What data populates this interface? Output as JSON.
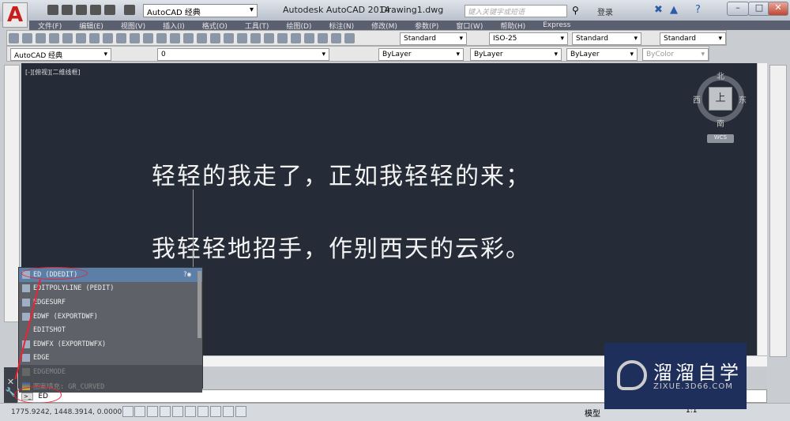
{
  "titlebar": {
    "app_title": "Autodesk AutoCAD 2014",
    "doc_title": "Drawing1.dwg",
    "workspace": "AutoCAD 经典",
    "search_placeholder": "键入关键字或短语",
    "login": "登录"
  },
  "menu": [
    "文件(F)",
    "编辑(E)",
    "视图(V)",
    "插入(I)",
    "格式(O)",
    "工具(T)",
    "绘图(D)",
    "标注(N)",
    "修改(M)",
    "参数(P)",
    "窗口(W)",
    "帮助(H)",
    "Express"
  ],
  "toolbar": {
    "text_style": "Standard",
    "dim_style": "ISO-25",
    "table_style": "Standard",
    "mleader_style": "Standard",
    "workspace": "AutoCAD 经典",
    "layer": "0",
    "color": "ByLayer",
    "linetype": "ByLayer",
    "lineweight": "ByLayer",
    "plotstyle": "ByColor"
  },
  "canvas": {
    "view_label": "[-][俯视][二维线框]",
    "line1": "轻轻的我走了，正如我轻轻的来；",
    "line2": "我轻轻地招手，作别西天的云彩。"
  },
  "viewcube": {
    "north": "北",
    "south": "南",
    "east": "东",
    "west": "西",
    "face": "上",
    "wcs": "WCS"
  },
  "autocomplete": [
    "ED (DDEDIT)",
    "EDITPOLYLINE (PEDIT)",
    "EDGESURF",
    "EDWF (EXPORTDWF)",
    "EDITSHOT",
    "EDWFX (EXPORTDWFX)",
    "EDGE",
    "EDGEMODE",
    "图案填充: GR_CURVED"
  ],
  "command": {
    "value": "ED"
  },
  "status": {
    "coords": "1775.9242, 1448.3914, 0.0000",
    "model": "模型",
    "scale": "1:1"
  },
  "watermark": {
    "name": "溜溜自学",
    "url": "ZIXUE.3D66.COM"
  }
}
